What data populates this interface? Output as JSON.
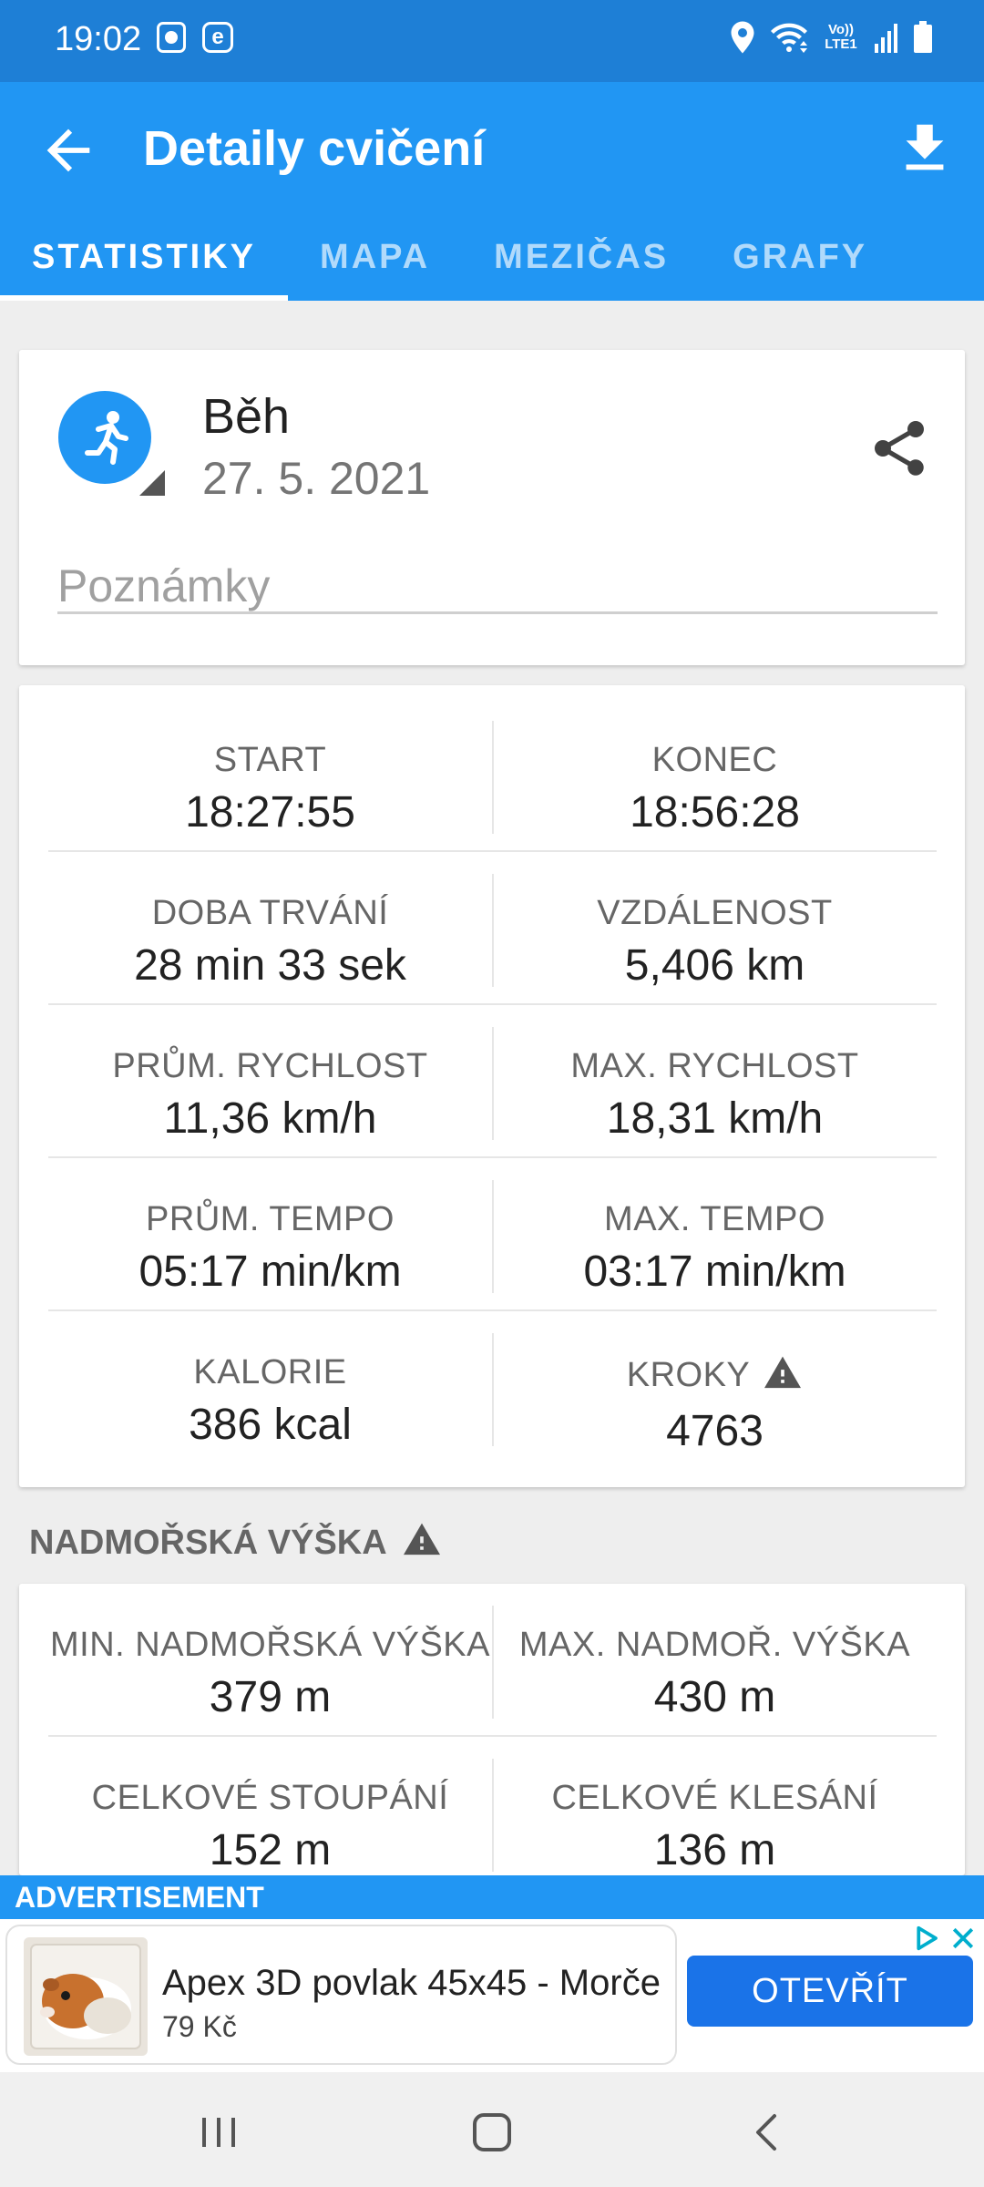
{
  "status_bar": {
    "time": "19:02",
    "left_icons": [
      "screenshot-icon",
      "e-app-icon"
    ],
    "right_icons": [
      "location-icon",
      "wifi-icon",
      "volte-icon",
      "signal-icon",
      "battery-icon"
    ],
    "volte_text": "Vo)) LTE1"
  },
  "header": {
    "title": "Detaily cvičení"
  },
  "tabs": [
    {
      "label": "STATISTIKY",
      "active": true
    },
    {
      "label": "MAPA",
      "active": false
    },
    {
      "label": "MEZIČAS",
      "active": false
    },
    {
      "label": "GRAFY",
      "active": false
    }
  ],
  "activity": {
    "name": "Běh",
    "date": "27. 5. 2021",
    "notes_placeholder": "Poznámky",
    "icon": "running-icon"
  },
  "stats": [
    {
      "left_label": "START",
      "left_value": "18:27:55",
      "right_label": "KONEC",
      "right_value": "18:56:28"
    },
    {
      "left_label": "DOBA TRVÁNÍ",
      "left_value": "28 min 33 sek",
      "right_label": "VZDÁLENOST",
      "right_value": "5,406 km"
    },
    {
      "left_label": "PRŮM. RYCHLOST",
      "left_value": "11,36 km/h",
      "right_label": "MAX. RYCHLOST",
      "right_value": "18,31 km/h"
    },
    {
      "left_label": "PRŮM. TEMPO",
      "left_value": "05:17 min/km",
      "right_label": "MAX. TEMPO",
      "right_value": "03:17 min/km"
    },
    {
      "left_label": "KALORIE",
      "left_value": "386 kcal",
      "right_label": "KROKY",
      "right_value": "4763"
    }
  ],
  "elevation": {
    "section_title": "NADMOŘSKÁ VÝŠKA",
    "rows": [
      {
        "left_label": "MIN. NADMOŘSKÁ VÝŠKA",
        "left_value": "379 m",
        "right_label": "MAX. NADMOŘ. VÝŠKA",
        "right_value": "430 m"
      },
      {
        "left_label": "CELKOVÉ STOUPÁNÍ",
        "left_value": "152 m",
        "right_label": "CELKOVÉ KLESÁNÍ",
        "right_value": "136 m"
      }
    ]
  },
  "ad": {
    "label": "ADVERTISEMENT",
    "title": "Apex 3D povlak 45x45 - Morče",
    "price": "79 Kč",
    "button": "OTEVŘÍT"
  },
  "colors": {
    "primary": "#2196f3",
    "status_bar": "#1e7fd6",
    "ad_button": "#1a73e8",
    "warning": "#555555"
  }
}
